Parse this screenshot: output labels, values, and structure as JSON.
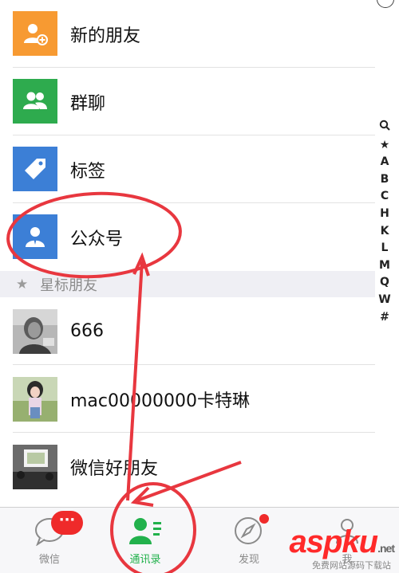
{
  "menu": [
    {
      "label": "新的朋友",
      "icon": "add-friend-icon"
    },
    {
      "label": "群聊",
      "icon": "group-chat-icon"
    },
    {
      "label": "标签",
      "icon": "tag-icon"
    },
    {
      "label": "公众号",
      "icon": "official-account-icon"
    }
  ],
  "section": {
    "title": "星标朋友",
    "icon": "star-icon"
  },
  "contacts": [
    {
      "name": "666"
    },
    {
      "name": "mac00000000卡特琳"
    },
    {
      "name": "微信好朋友"
    }
  ],
  "index_letters": [
    "Q",
    "★",
    "A",
    "B",
    "C",
    "H",
    "K",
    "L",
    "M",
    "Q",
    "W",
    "#"
  ],
  "tabs": [
    {
      "label": "微信",
      "badge": "···"
    },
    {
      "label": "通讯录"
    },
    {
      "label": "发现"
    },
    {
      "label": "我"
    }
  ],
  "watermark": {
    "brand": "aspku",
    "suffix": ".net",
    "subtitle": "免费网站源码下载站"
  },
  "colors": {
    "orange": "#f79a32",
    "green": "#2eab4e",
    "blue": "#3c7fd6",
    "active_tab": "#22b14c",
    "annotation": "#e8373f"
  }
}
